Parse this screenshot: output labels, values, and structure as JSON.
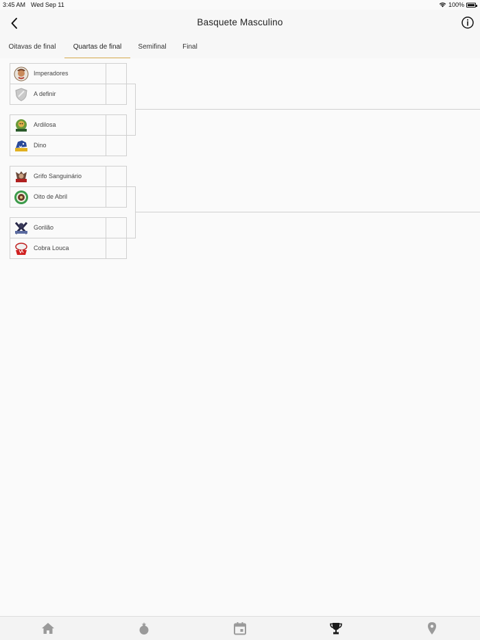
{
  "status_bar": {
    "time": "3:45 AM",
    "date": "Wed Sep 11",
    "battery": "100%"
  },
  "nav": {
    "title": "Basquete Masculino",
    "back_icon": "chevron-left-icon",
    "info_icon": "info-circle-icon"
  },
  "tabs": [
    {
      "label": "Oitavas de final",
      "active": false
    },
    {
      "label": "Quartas de final",
      "active": true
    },
    {
      "label": "Semifinal",
      "active": false
    },
    {
      "label": "Final",
      "active": false
    }
  ],
  "matches": [
    {
      "teams": [
        {
          "name": "Imperadores",
          "score": ""
        },
        {
          "name": "A definir",
          "score": ""
        }
      ]
    },
    {
      "teams": [
        {
          "name": "Ardilosa",
          "score": ""
        },
        {
          "name": "Dino",
          "score": ""
        }
      ]
    },
    {
      "teams": [
        {
          "name": "Grifo Sanguinário",
          "score": ""
        },
        {
          "name": "Oito de Abril",
          "score": ""
        }
      ]
    },
    {
      "teams": [
        {
          "name": "Gorilão",
          "score": ""
        },
        {
          "name": "Cobra Louca",
          "score": ""
        }
      ]
    }
  ],
  "bottom_nav": [
    {
      "icon": "home-icon",
      "active": false
    },
    {
      "icon": "medal-icon",
      "active": false
    },
    {
      "icon": "calendar-icon",
      "active": false
    },
    {
      "icon": "trophy-icon",
      "active": true
    },
    {
      "icon": "location-pin-icon",
      "active": false
    }
  ],
  "colors": {
    "accent": "#d4a84a",
    "icon_inactive": "#9a9a9a",
    "icon_active": "#1a1a1a"
  }
}
